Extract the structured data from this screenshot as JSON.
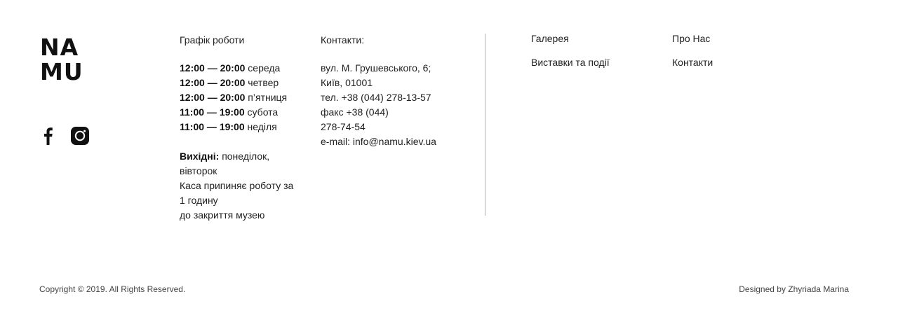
{
  "logo": {
    "line1": "NA",
    "line2": "MU"
  },
  "social": {
    "facebook_icon": "facebook-icon",
    "instagram_icon": "instagram-icon"
  },
  "hours": {
    "title": "Графік роботи",
    "rows": [
      {
        "time": "12:00 — 20:00",
        "day": "середа"
      },
      {
        "time": "12:00 — 20:00",
        "day": " четвер"
      },
      {
        "time": "12:00 — 20:00",
        "day": "п’ятниця"
      },
      {
        "time": "11:00 — 19:00",
        "day": "субота"
      },
      {
        "time": "11:00 — 19:00",
        "day": "неділя"
      }
    ],
    "weekend_label": "Вихідні:",
    "weekend_days_1": "понеділок,",
    "weekend_days_2": "вівторок",
    "note_1": "Каса припиняє роботу за",
    "note_2": "1 годину",
    "note_3": "до закриття музею"
  },
  "contacts": {
    "title": "Контакти:",
    "address_1": "вул. М. Грушевського, 6;",
    "address_2": "Київ, 01001",
    "phone": "тел. +38 (044) 278-13-57",
    "fax_1": "факс +38 (044)",
    "fax_2": "278-74-54",
    "email": "e-mail: info@namu.kiev.ua"
  },
  "nav": {
    "gallery": "Галерея",
    "exhibitions": "Виставки та події",
    "about": "Про Нас",
    "contacts": "Контакти"
  },
  "footer": {
    "copyright": "Copyright © 2019. All Rights Reserved.",
    "designer": "Designed by Zhyriada Marina"
  },
  "colors": {
    "divider": "#9bbcbf",
    "text": "#222222"
  }
}
